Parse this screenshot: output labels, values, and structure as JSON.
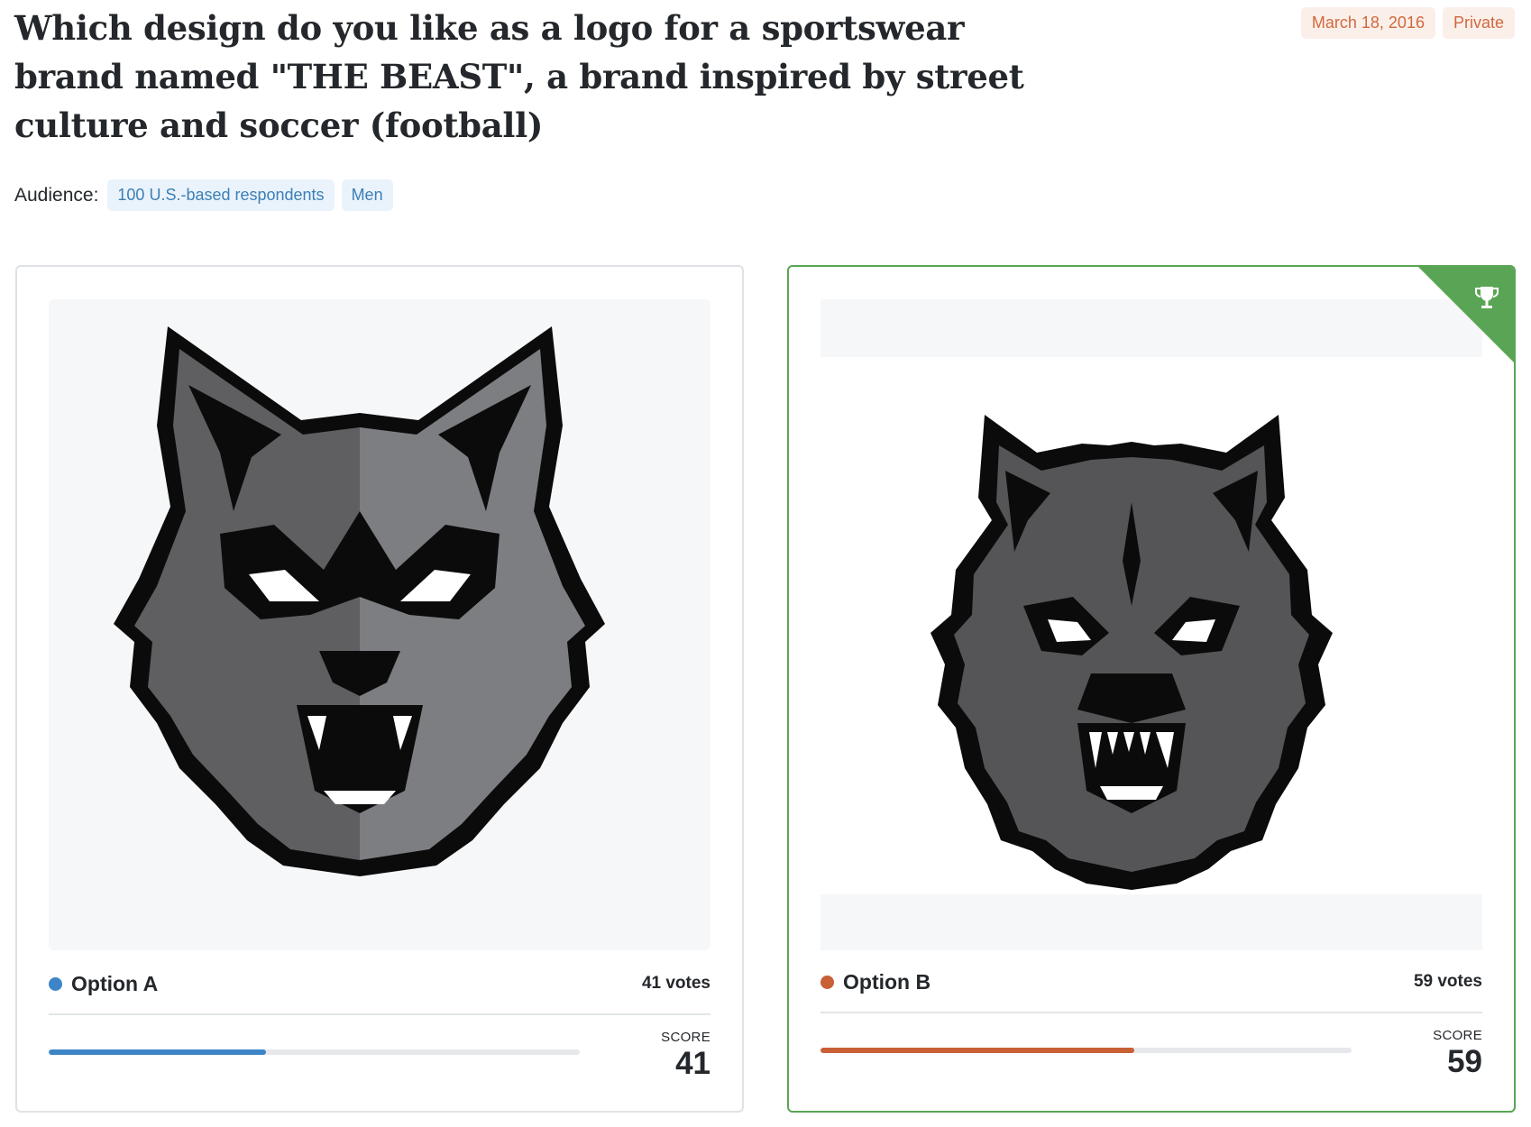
{
  "question": {
    "title": "Which design do you like as a logo for a sportswear brand named \"THE BEAST\", a brand inspired by street culture and soccer (football)",
    "date": "March 18, 2016",
    "visibility": "Private"
  },
  "audience": {
    "label": "Audience:",
    "tags": [
      "100 U.S.-based respondents",
      "Men"
    ]
  },
  "options": [
    {
      "label": "Option A",
      "votes_text": "41 votes",
      "score_label": "SCORE",
      "score": "41",
      "score_fraction": 0.41,
      "color": "#3d85c6",
      "image_icon": "wolf-logo-icon",
      "winner": false
    },
    {
      "label": "Option B",
      "votes_text": "59 votes",
      "score_label": "SCORE",
      "score": "59",
      "score_fraction": 0.59,
      "color": "#c85f35",
      "image_icon": "werewolf-logo-icon",
      "winner": true,
      "winner_icon": "trophy-icon"
    }
  ],
  "colors": {
    "accent_private": "#d0693e",
    "tag_text": "#3b7fb6",
    "winner_border": "#5aa555"
  }
}
